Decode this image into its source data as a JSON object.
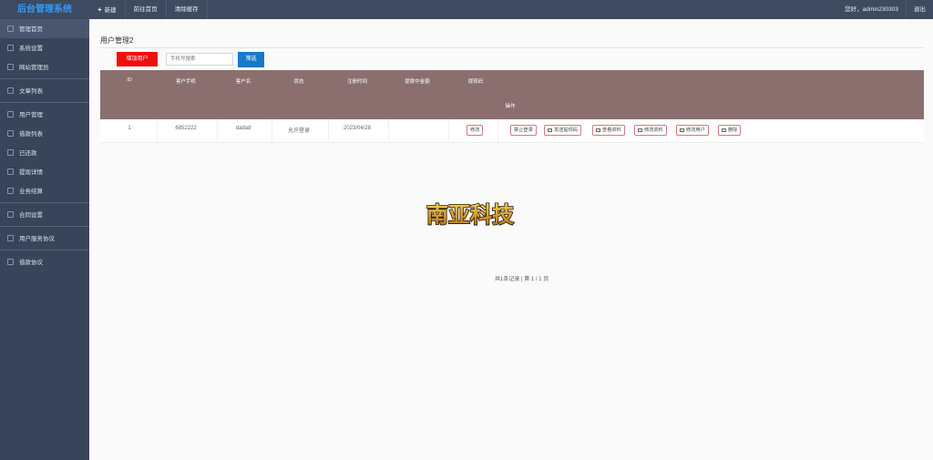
{
  "brand": "后台管理系统",
  "topnav": {
    "new_label": "新建",
    "home_label": "前往首页",
    "clear_label": "清除缓存",
    "greeting": "您好，admin230303",
    "logout": "退出"
  },
  "sidebar": {
    "items": [
      {
        "label": "管理首页"
      },
      {
        "label": "系统设置"
      },
      {
        "label": "网站管理员"
      },
      {
        "label": "文章列表"
      },
      {
        "label": "用户管理"
      },
      {
        "label": "借款列表"
      },
      {
        "label": "已还款"
      },
      {
        "label": "提现详情"
      },
      {
        "label": "业务结算"
      },
      {
        "label": "合同设置"
      },
      {
        "label": "用户服务协议"
      },
      {
        "label": "借款协议"
      }
    ]
  },
  "page": {
    "title": "用户管理2",
    "add_button": "增加用户",
    "search_placeholder": "手机号搜索",
    "search_button": "筛选"
  },
  "table": {
    "headers": [
      "ID",
      "客户手机",
      "客户名",
      "状态",
      "注册时间",
      "提款中金额",
      "提现码",
      "操作"
    ],
    "row": {
      "id": "1",
      "phone": "6852222",
      "name": "dadad",
      "status": "允许登录",
      "reg_time": "2023/04/28",
      "withdraw_amount": "",
      "code_button": "修改"
    },
    "actions": [
      "禁止登录",
      "发送提现码",
      "查看资料",
      "修改资料",
      "修改用户",
      "删除"
    ]
  },
  "logo_text": "南亚科技",
  "pagination": "共1条记录 | 第 1 / 1 页"
}
